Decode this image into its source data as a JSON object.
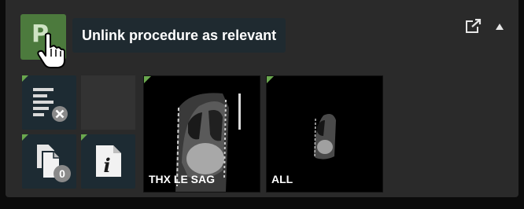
{
  "tooltip": {
    "text": "Unlink procedure as relevant"
  },
  "procedure_button": {
    "glyph": "P",
    "icon": "relevance-toggle-icon"
  },
  "header_icons": {
    "popout": "popout-icon",
    "collapse": "collapse-arrow-icon"
  },
  "tools": [
    {
      "name": "report-tool",
      "icon": "report-remove-icon"
    },
    {
      "name": "documents-tool",
      "icon": "documents-icon",
      "badge": "0"
    },
    {
      "name": "info-tool",
      "icon": "info-icon",
      "glyph": "i"
    }
  ],
  "thumbnails": [
    {
      "label": "THX LE SAG"
    },
    {
      "label": "ALL"
    }
  ],
  "colors": {
    "accent_green": "#6aa84f",
    "button_green": "#4c7a3d",
    "tooltip_bg": "#1f2a30"
  }
}
